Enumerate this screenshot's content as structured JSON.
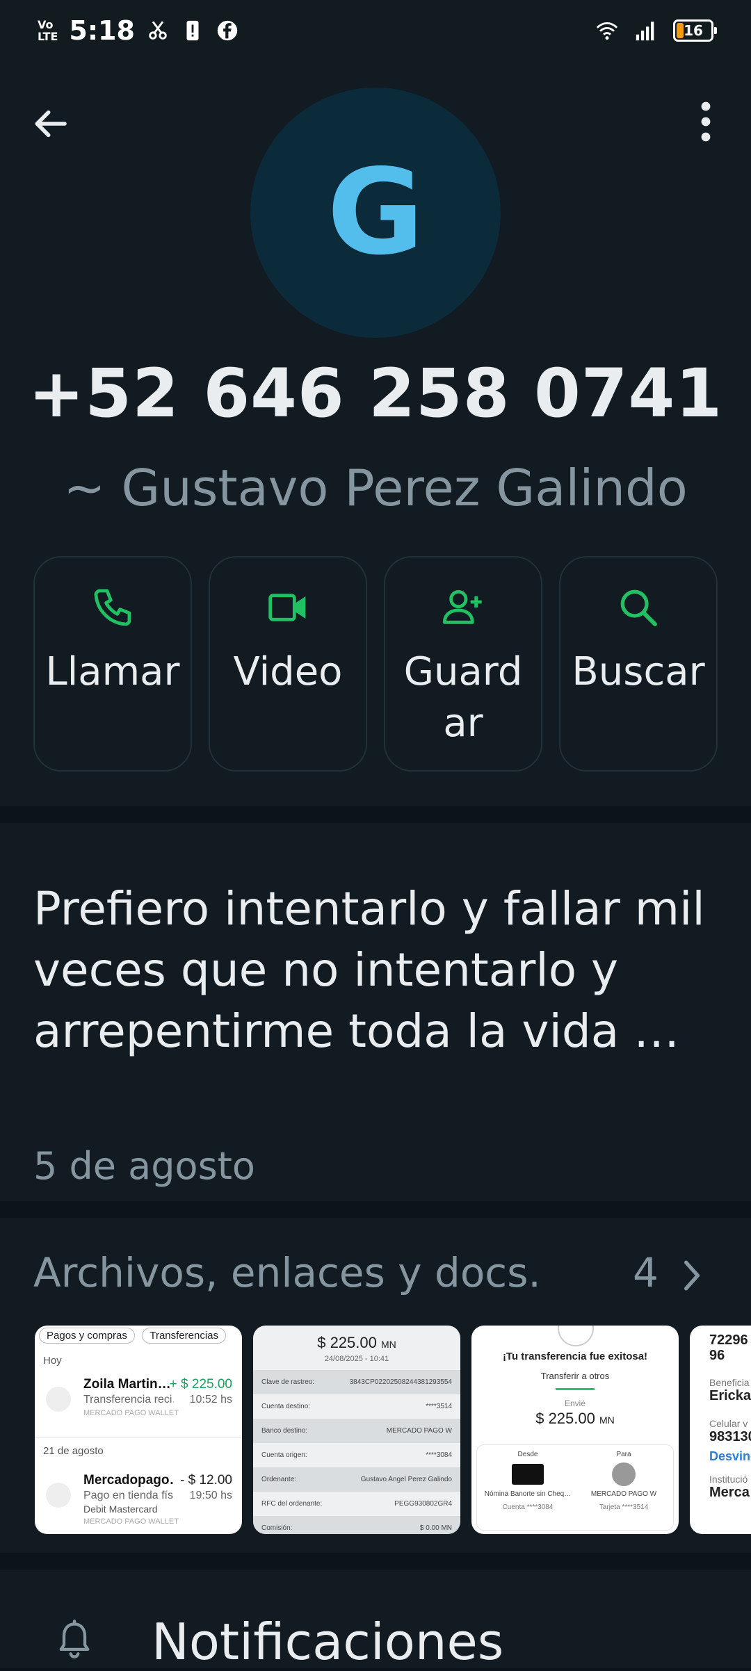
{
  "status_bar": {
    "network": "Vo LTE",
    "time": "5:18",
    "battery": "16"
  },
  "contact": {
    "avatar_letter": "G",
    "phone": "+52 646 258 0741",
    "alias": "~ Gustavo Perez Galindo"
  },
  "actions": [
    {
      "label": "Llamar",
      "icon": "phone-icon"
    },
    {
      "label": "Video",
      "icon": "video-icon"
    },
    {
      "label": "Guardar",
      "icon": "add-contact-icon"
    },
    {
      "label": "Buscar",
      "icon": "search-icon"
    }
  ],
  "about": {
    "text": "Prefiero intentarlo y fallar mil veces que no intentarlo y arrepentirme toda la vida …",
    "date": "5 de agosto"
  },
  "media": {
    "title": "Archivos, enlaces y docs.",
    "count": "4",
    "thumb1": {
      "tab1": "Pagos y compras",
      "tab2": "Transferencias",
      "today": "Hoy",
      "row1_name": "Zoila Martin…",
      "row1_amount": "+ $ 225.00",
      "row1_sub": "Transferencia reci…",
      "row1_time": "10:52 hs",
      "row1_tiny": "MERCADO PAGO WALLET",
      "date2": "21 de agosto",
      "row2_name": "Mercadopago…",
      "row2_amount": "- $ 12.00",
      "row2_sub": "Pago en tienda fís…",
      "row2_time": "19:50 hs",
      "row2_card": "Debit Mastercard",
      "row2_tiny": "MERCADO PAGO WALLET"
    },
    "thumb2": {
      "amount": "$ 225.00",
      "currency": "MN",
      "date": "24/08/2025 - 10:41",
      "rows": [
        {
          "k": "Clave de rastreo:",
          "v": "3843CP02202508244381293554"
        },
        {
          "k": "Cuenta destino:",
          "v": "****3514"
        },
        {
          "k": "Banco destino:",
          "v": "MERCADO PAGO W"
        },
        {
          "k": "Cuenta origen:",
          "v": "****3084"
        },
        {
          "k": "Ordenante:",
          "v": "Gustavo Angel Perez Galindo"
        },
        {
          "k": "RFC del ordenante:",
          "v": "PEGG930802GR4"
        },
        {
          "k": "Comisión:",
          "v": "$ 0.00 MN"
        }
      ]
    },
    "thumb3": {
      "title": "¡Tu transferencia fue exitosa!",
      "subtitle": "Transferir a otros",
      "sent_label": "Envié",
      "amount": "$ 225.00",
      "currency": "MN",
      "from_label": "Desde",
      "to_label": "Para",
      "from_name": "Nómina Banorte sin Cheq…",
      "to_name": "MERCADO PAGO W",
      "from_acct": "Cuenta ****3084",
      "to_acct": "Tarjeta ****3514"
    },
    "thumb4": {
      "line1": "72296",
      "line2": "96",
      "label1": "Beneficia",
      "value1": "Ericka",
      "label2": "Celular v",
      "value2": "983130",
      "link": "Desvinc",
      "label3": "Institució",
      "value3": "Merca"
    }
  },
  "notifications": {
    "label": "Notificaciones"
  },
  "colors": {
    "accent_green": "#21c063",
    "avatar_bg": "#0b2a3a",
    "avatar_letter": "#53bdeb",
    "background": "#111b21"
  }
}
